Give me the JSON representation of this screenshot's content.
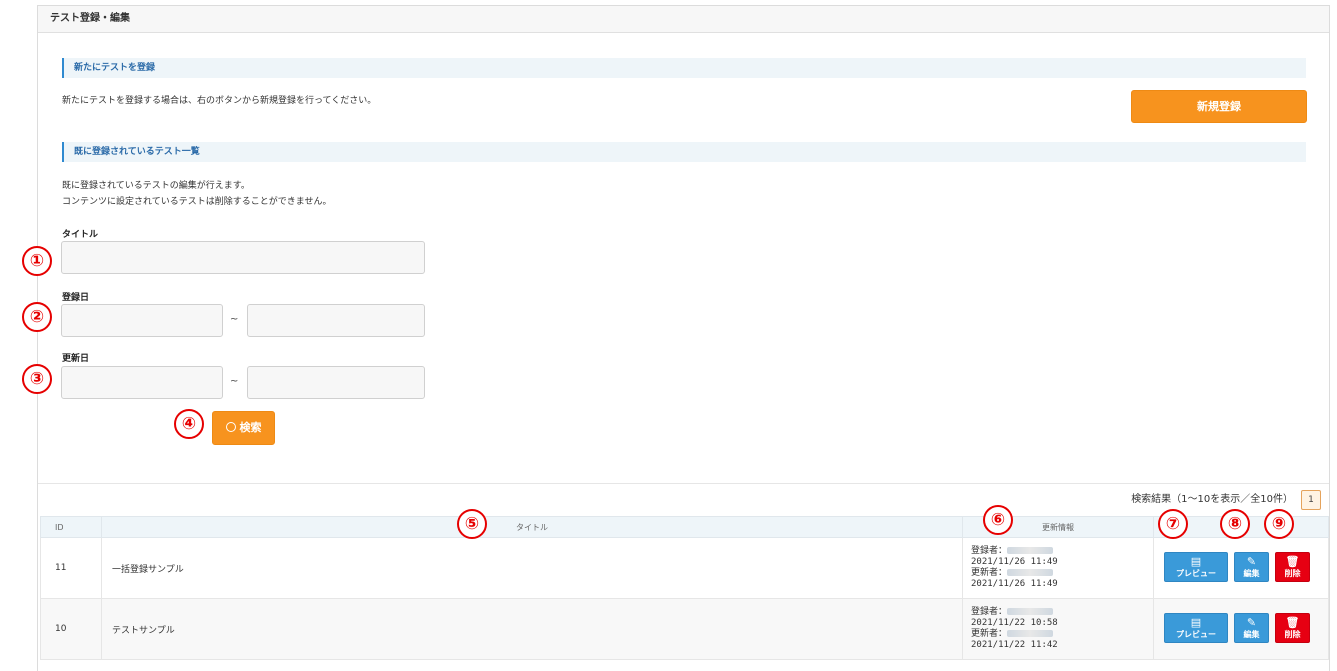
{
  "header": {
    "title": "テスト登録・編集"
  },
  "new_section": {
    "heading": "新たにテストを登録",
    "description": "新たにテストを登録する場合は、右のボタンから新規登録を行ってください。",
    "new_button": "新規登録"
  },
  "list_section": {
    "heading": "既に登録されているテスト一覧",
    "description_line1": "既に登録されているテストの編集が行えます。",
    "description_line2": "コンテンツに設定されているテストは削除することができません。"
  },
  "search": {
    "title_label": "タイトル",
    "title_value": "",
    "registered_label": "登録日",
    "updated_label": "更新日",
    "range_separator": "~",
    "search_button": "検索"
  },
  "markers": [
    "①",
    "②",
    "③",
    "④",
    "⑤",
    "⑥",
    "⑦",
    "⑧",
    "⑨"
  ],
  "results": {
    "info": "検索結果（1～10を表示／全10件）",
    "page": "1"
  },
  "table": {
    "headers": {
      "id": "ID",
      "title": "タイトル",
      "update_info": "更新情報"
    },
    "rows": [
      {
        "id": "11",
        "title": "一括登録サンプル",
        "registered_by": "登録者：",
        "registered_at": "2021/11/26 11:49",
        "updated_by": "更新者：",
        "updated_at": "2021/11/26 11:49"
      },
      {
        "id": "10",
        "title": "テストサンプル",
        "registered_by": "登録者：",
        "registered_at": "2021/11/22 10:58",
        "updated_by": "更新者：",
        "updated_at": "2021/11/22 11:42"
      }
    ],
    "actions": {
      "preview": "プレビュー",
      "edit": "編集",
      "delete": "削除"
    }
  },
  "colors": {
    "accent_orange": "#f7931e",
    "blue": "#3a9ad9",
    "red": "#e60012",
    "marker_red": "#e60000"
  },
  "icons": {
    "search": "search-icon",
    "preview": "preview-icon",
    "edit": "pencil-icon",
    "delete": "trash-icon"
  }
}
